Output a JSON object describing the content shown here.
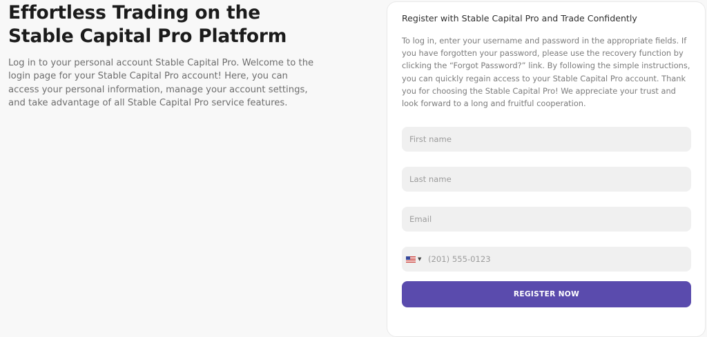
{
  "hero": {
    "headline": "Effortless Trading on the Stable Capital Pro Platform",
    "intro": "Log in to your personal account Stable Capital Pro. Welcome to the login page for your Stable Capital Pro account! Here, you can access your personal information, manage your account settings, and take advantage of all Stable Capital Pro service features."
  },
  "form": {
    "title": "Register with Stable Capital Pro and Trade Confidently",
    "description": "To log in, enter your username and password in the appropriate fields. If you have forgotten your password, please use the recovery function by clicking the “Forgot Password?” link. By following the simple instructions, you can quickly regain access to your Stable Capital Pro account. Thank you for choosing the Stable Capital Pro! We appreciate your trust and look forward to a long and fruitful cooperation.",
    "first_name": {
      "value": "",
      "placeholder": "First name"
    },
    "last_name": {
      "value": "",
      "placeholder": "Last name"
    },
    "email": {
      "value": "",
      "placeholder": "Email"
    },
    "phone": {
      "country_icon": "us-flag-icon",
      "value": "",
      "placeholder": "(201) 555-0123"
    },
    "submit_label": "REGISTER NOW"
  },
  "colors": {
    "page_background": "#f8f8f8",
    "card_background": "#ffffff",
    "field_background": "#f0f0f0",
    "accent": "#5a4bad"
  }
}
